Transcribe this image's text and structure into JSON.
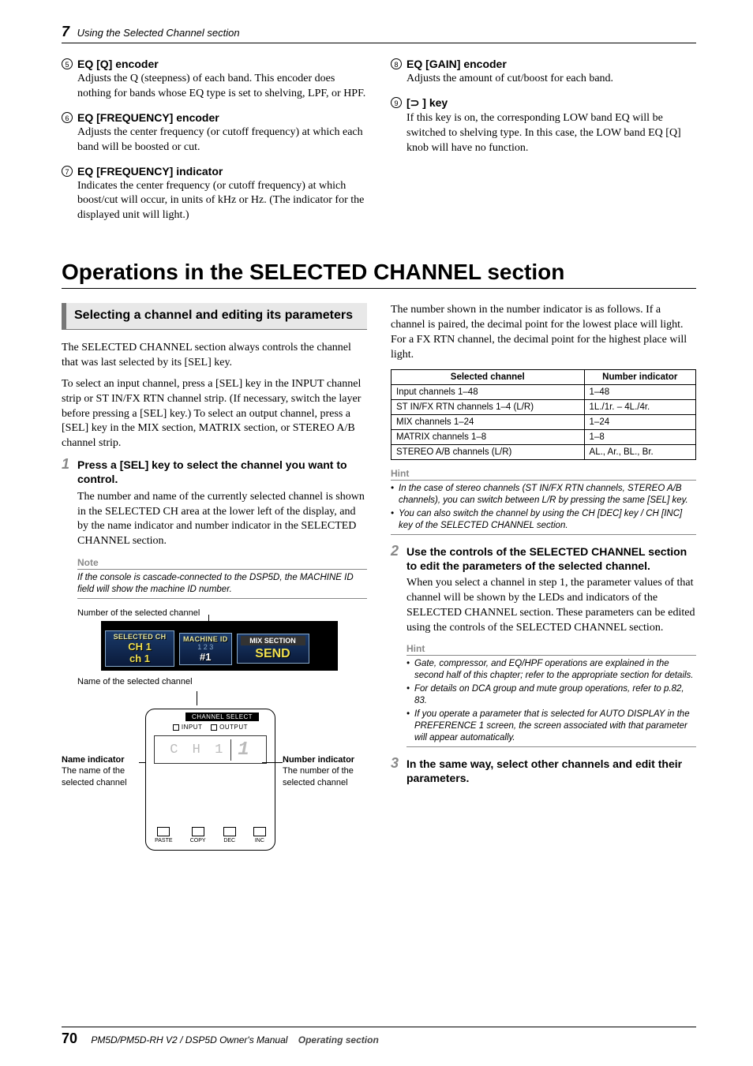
{
  "running_head": {
    "chapter_number": "7",
    "title": "Using the Selected Channel section"
  },
  "items": {
    "i5": {
      "num": "5",
      "title": "EQ [Q] encoder",
      "body": "Adjusts the Q (steepness) of each band. This encoder does nothing for bands whose EQ type is set to shelving, LPF, or HPF."
    },
    "i6": {
      "num": "6",
      "title": "EQ [FREQUENCY] encoder",
      "body": "Adjusts the center frequency (or cutoff frequency) at which each band will be boosted or cut."
    },
    "i7": {
      "num": "7",
      "title": "EQ [FREQUENCY] indicator",
      "body": "Indicates the center frequency (or cutoff frequency) at which boost/cut will occur, in units of kHz or Hz. (The indicator for the displayed unit will light.)"
    },
    "i8": {
      "num": "8",
      "title": "EQ [GAIN] encoder",
      "body": "Adjusts the amount of cut/boost for each band."
    },
    "i9": {
      "num": "9",
      "title_prefix": "[",
      "title_icon": "⊃",
      "title_suffix": " ] key",
      "body": "If this key is on, the corresponding LOW band EQ will be switched to shelving type. In this case, the LOW band EQ [Q] knob will have no function."
    }
  },
  "h1": "Operations in the SELECTED CHANNEL section",
  "subhead": "Selecting a channel and editing its parameters",
  "intro1": "The SELECTED CHANNEL section always controls the channel that was last selected by its [SEL] key.",
  "intro2": "To select an input channel, press a [SEL] key in the INPUT channel strip or ST IN/FX RTN channel strip. (If necessary, switch the layer before pressing a [SEL] key.) To select an output channel, press a [SEL] key in the MIX section, MATRIX section, or STEREO A/B channel strip.",
  "steps": {
    "s1": {
      "num": "1",
      "title": "Press a [SEL] key to select the channel you want to control.",
      "body": "The number and name of the currently selected channel is shown in the SELECTED CH area at the lower left of the display, and by the name indicator and number indicator in the SELECTED CHANNEL section."
    },
    "s2": {
      "num": "2",
      "title": "Use the controls of the SELECTED CHANNEL section to edit the parameters of the selected channel.",
      "body": "When you select a channel in step 1, the parameter values of that channel will be shown by the LEDs and indicators of the SELECTED CHANNEL section. These parameters can be edited using the controls of the SELECTED CHANNEL section."
    },
    "s3": {
      "num": "3",
      "title": "In the same way, select other channels and edit their parameters."
    }
  },
  "note": {
    "head": "Note",
    "body": "If the console is cascade-connected to the DSP5D, the MACHINE ID field will show the machine ID number."
  },
  "captions": {
    "top": "Number of the selected channel",
    "bottom": "Name of the selected channel"
  },
  "lcd": {
    "sel_h": "SELECTED CH",
    "sel_l1": "CH  1",
    "sel_l2": "ch  1",
    "mid_h": "MACHINE ID",
    "mid_nums": "1 2 3",
    "mid_v": "#1",
    "mix_h": "MIX SECTION",
    "mix_v": "SEND"
  },
  "panel": {
    "title": "CHANNEL SELECT",
    "input": "INPUT",
    "output": "OUTPUT",
    "disp_l": "C H   1",
    "disp_r": "1",
    "b1": "PASTE",
    "b2": "COPY",
    "b3": "DEC",
    "b4": "INC",
    "left_t1": "Name",
    "left_t2": "indicator",
    "left_body": "The name of the selected channel",
    "right_t1": "Number",
    "right_t2": "indicator",
    "right_body": "The number of the selected channel"
  },
  "rcol_intro": "The number shown in the number indicator is as follows. If a channel is paired, the decimal point for the lowest place will light. For a FX RTN channel, the decimal point for the highest place will light.",
  "table": {
    "h1": "Selected channel",
    "h2": "Number indicator",
    "rows": [
      {
        "c1": "Input channels 1–48",
        "c2": "1–48"
      },
      {
        "c1": "ST IN/FX RTN channels 1–4 (L/R)",
        "c2": "1L./1r. – 4L./4r."
      },
      {
        "c1": "MIX channels 1–24",
        "c2": "1–24"
      },
      {
        "c1": "MATRIX channels 1–8",
        "c2": "1–8"
      },
      {
        "c1": "STEREO A/B channels (L/R)",
        "c2": "AL., Ar., BL., Br."
      }
    ]
  },
  "hint1": {
    "head": "Hint",
    "b1": "In the case of stereo channels (ST IN/FX RTN channels, STEREO A/B channels), you can switch between L/R by pressing the same [SEL] key.",
    "b2": "You can also switch the channel by using the CH [DEC] key / CH [INC] key of the SELECTED CHANNEL section."
  },
  "hint2": {
    "head": "Hint",
    "b1": "Gate, compressor, and EQ/HPF operations are explained in the second half of this chapter; refer to the appropriate section for details.",
    "b2": "For details on DCA group and mute group operations, refer to p.82, 83.",
    "b3": "If you operate a parameter that is selected for AUTO DISPLAY in the PREFERENCE 1 screen, the screen associated with that parameter will appear automatically."
  },
  "footer": {
    "page": "70",
    "doc": "PM5D/PM5D-RH V2 / DSP5D Owner's Manual",
    "section": "Operating section"
  }
}
